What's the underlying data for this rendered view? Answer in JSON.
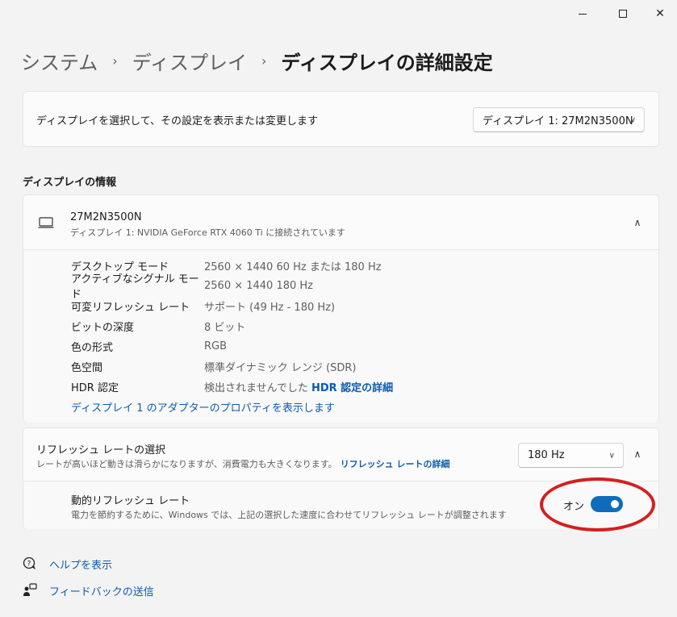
{
  "window": {
    "minimize": "minimize",
    "maximize": "maximize",
    "close": "✕"
  },
  "breadcrumb": {
    "items": [
      "システム",
      "ディスプレイ"
    ],
    "separator": "›",
    "current": "ディスプレイの詳細設定"
  },
  "display_select": {
    "label": "ディスプレイを選択して、その設定を表示または変更します",
    "value": "ディスプレイ 1: 27M2N3500N"
  },
  "info_section": {
    "title": "ディスプレイの情報"
  },
  "monitor": {
    "name": "27M2N3500N",
    "subtitle": "ディスプレイ 1: NVIDIA GeForce RTX 4060 Ti に接続されています",
    "rows": [
      {
        "key": "デスクトップ モード",
        "value": "2560 × 1440 60 Hz または 180 Hz"
      },
      {
        "key": "アクティブなシグナル モード",
        "value": "2560 × 1440 180 Hz"
      },
      {
        "key": "可変リフレッシュ レート",
        "value": "サポート (49 Hz - 180 Hz)"
      },
      {
        "key": "ビットの深度",
        "value": "8 ビット"
      },
      {
        "key": "色の形式",
        "value": "RGB"
      },
      {
        "key": "色空間",
        "value": "標準ダイナミック レンジ (SDR)"
      },
      {
        "key": "HDR 認定",
        "value": "検出されませんでした",
        "link": "HDR 認定の詳細"
      }
    ],
    "adapter_link": "ディスプレイ 1 のアダプターのプロパティを表示します"
  },
  "refresh": {
    "title": "リフレッシュ レートの選択",
    "subtitle": "レートが高いほど動きは滑らかになりますが、消費電力も大きくなります。",
    "link": "リフレッシュ レートの詳細",
    "value": "180 Hz",
    "dynamic": {
      "title": "動的リフレッシュ レート",
      "subtitle": "電力を節約するために、Windows では、上記の選択した速度に合わせてリフレッシュ レートが調整されます",
      "toggle_label": "オン",
      "enabled": true
    }
  },
  "footer": {
    "help": "ヘルプを表示",
    "feedback": "フィードバックの送信"
  },
  "colors": {
    "accent": "#0f6cbd",
    "link": "#0b5cad",
    "annotation": "#d41f1f"
  }
}
